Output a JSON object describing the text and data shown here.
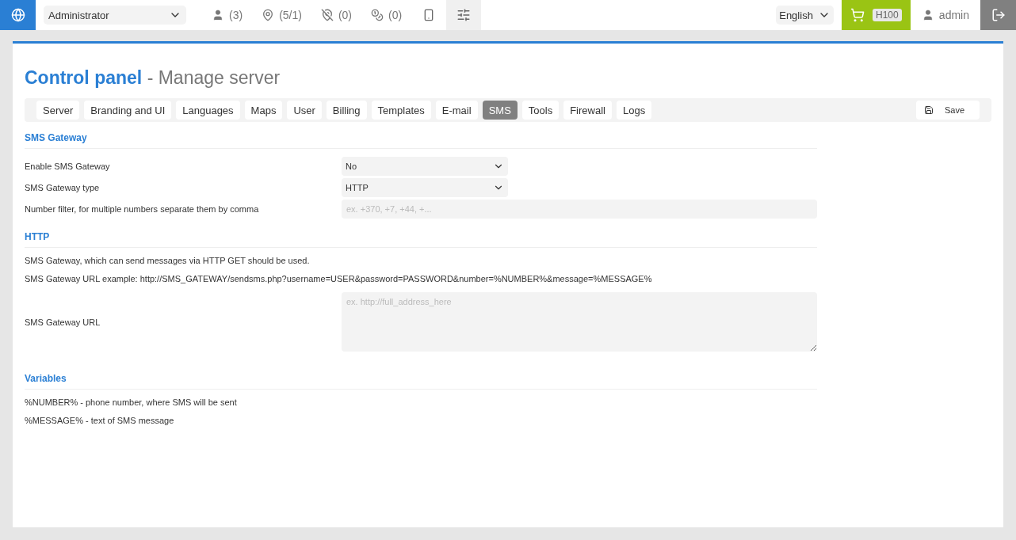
{
  "topbar": {
    "role_select": "Administrator",
    "counters": [
      {
        "kind": "users",
        "text": "(3)"
      },
      {
        "kind": "places",
        "text": "(5/1)"
      },
      {
        "kind": "places_off",
        "text": "(0)"
      },
      {
        "kind": "coins",
        "text": "(0)"
      }
    ],
    "settings": {
      "selected": true
    },
    "language": "English",
    "cart_badge": "H100",
    "user": "admin"
  },
  "title": {
    "main": "Control panel",
    "sub": "- Manage server"
  },
  "tabs": [
    {
      "label": "Server",
      "selected": false
    },
    {
      "label": "Branding and UI",
      "selected": false
    },
    {
      "label": "Languages",
      "selected": false
    },
    {
      "label": "Maps",
      "selected": false
    },
    {
      "label": "User",
      "selected": false
    },
    {
      "label": "Billing",
      "selected": false
    },
    {
      "label": "Templates",
      "selected": false
    },
    {
      "label": "E-mail",
      "selected": false
    },
    {
      "label": "SMS",
      "selected": true
    },
    {
      "label": "Tools",
      "selected": false
    },
    {
      "label": "Firewall",
      "selected": false
    },
    {
      "label": "Logs",
      "selected": false
    }
  ],
  "save_button": "Save",
  "sections": [
    {
      "title": "SMS Gateway",
      "items": [
        {
          "kind": "select",
          "label": "Enable SMS Gateway",
          "value": "No"
        },
        {
          "kind": "select",
          "label": "SMS Gateway type",
          "value": "HTTP"
        },
        {
          "kind": "input",
          "label": "Number filter, for multiple numbers separate them by comma",
          "placeholder": "ex. +370, +7, +44, +..."
        }
      ]
    },
    {
      "title": "HTTP",
      "items": [
        {
          "kind": "text",
          "text": "SMS Gateway, which can send messages via HTTP GET should be used."
        },
        {
          "kind": "text",
          "text": "SMS Gateway URL example: http://SMS_GATEWAY/sendsms.php?username=USER&password=PASSWORD&number=%NUMBER%&message=%MESSAGE%"
        },
        {
          "kind": "textarea",
          "label": "SMS Gateway URL",
          "placeholder": "ex. http://full_address_here"
        }
      ]
    },
    {
      "title": "Variables",
      "items": [
        {
          "kind": "text",
          "text": "%NUMBER% - phone number, where SMS will be sent"
        },
        {
          "kind": "text",
          "text": "%MESSAGE% - text of SMS message"
        }
      ]
    }
  ]
}
